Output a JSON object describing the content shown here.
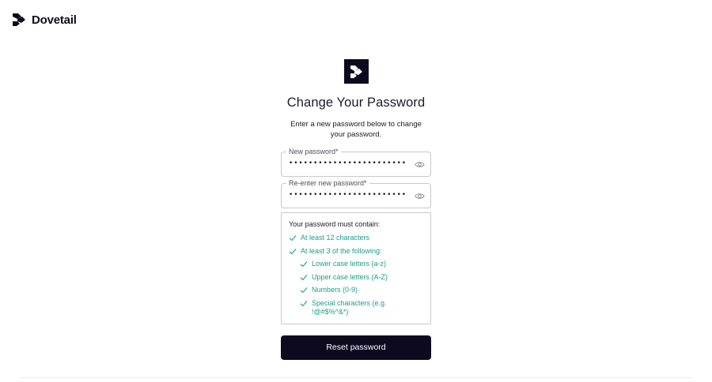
{
  "brand": {
    "name": "Dovetail",
    "icon": "dovetail-logo-icon"
  },
  "page": {
    "title": "Change Your Password",
    "subtitle": "Enter a new password below to change your password."
  },
  "form": {
    "new_password": {
      "label": "New password*",
      "value": "••••••••••••••••••••••••••"
    },
    "confirm_password": {
      "label": "Re-enter new password*",
      "value": "••••••••••••••••••••••••••"
    },
    "requirements": {
      "heading": "Your password must contain:",
      "items": [
        {
          "text": "At least 12 characters",
          "level": 0,
          "met": true
        },
        {
          "text": "At least 3 of the following:",
          "level": 0,
          "met": true
        },
        {
          "text": "Lower case letters (a-z)",
          "level": 1,
          "met": true
        },
        {
          "text": "Upper case letters (A-Z)",
          "level": 1,
          "met": true
        },
        {
          "text": "Numbers (0-9)",
          "level": 1,
          "met": true
        },
        {
          "text": "Special characters (e.g. !@#$%^&*)",
          "level": 1,
          "met": true
        }
      ]
    },
    "submit_label": "Reset password"
  },
  "colors": {
    "brand_dark": "#0d0a1f",
    "success": "#1a9e8a",
    "border": "#c9c8cf"
  }
}
